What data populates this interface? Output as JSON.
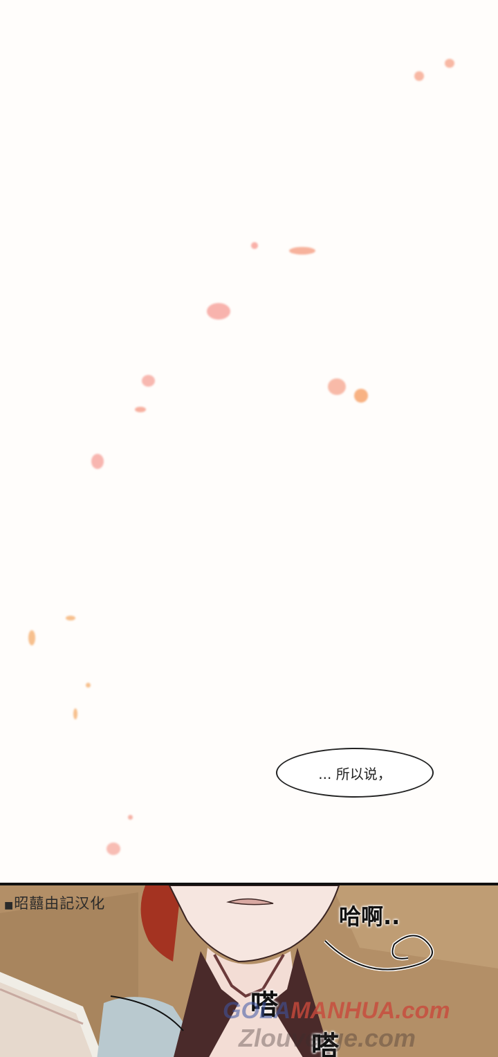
{
  "dialogue": {
    "text": "... 所以说，"
  },
  "panel": {
    "credit": "昭囍由記汉化",
    "sfx_haha": "哈啊..",
    "sfx_da1": "嗒",
    "sfx_da2": "嗒"
  },
  "watermarks": {
    "line1_a": "GOLA",
    "line1_b": "MANHUA.com",
    "line2": "Zlouverge.com"
  },
  "colors": {
    "background": "#fffdfb",
    "petal_pink": "#f6a7a0",
    "petal_orange": "#f7b27a",
    "panel_bg": "#b08d66",
    "watermark_red": "#c94a3c"
  }
}
